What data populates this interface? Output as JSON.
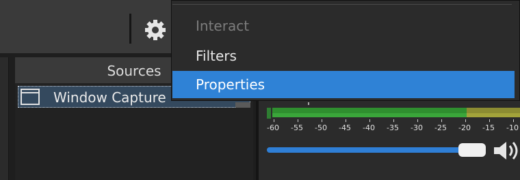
{
  "sources": {
    "header": "Sources",
    "items": [
      {
        "label": "Window Capture",
        "icon": "window-icon"
      }
    ]
  },
  "mixer": {
    "ticks": [
      "-60",
      "-55",
      "-50",
      "-45",
      "-40",
      "-35",
      "-30",
      "-25",
      "-20",
      "-15",
      "-10"
    ],
    "volume_level": 0.93
  },
  "context_menu": {
    "items": [
      {
        "label": "Interact",
        "state": "disabled"
      },
      {
        "label": "Filters",
        "state": "normal"
      },
      {
        "label": "Properties",
        "state": "highlighted"
      }
    ]
  },
  "colors": {
    "accent": "#2f82d6",
    "meter_green": "#2f8f2f",
    "meter_yellow": "#8c8c32"
  }
}
